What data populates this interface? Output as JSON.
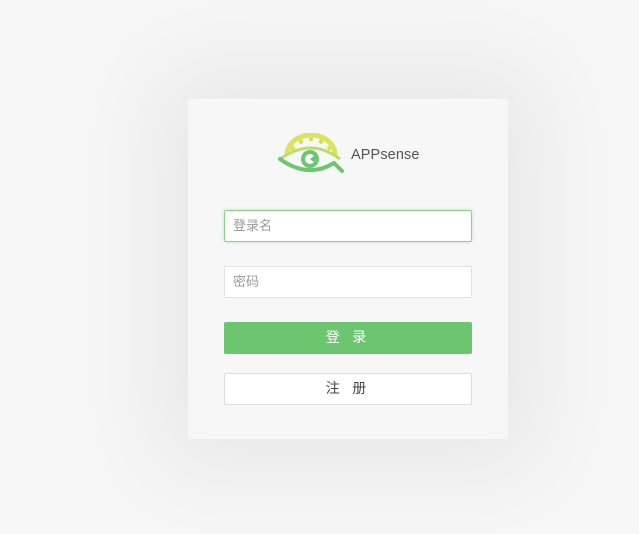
{
  "brand": {
    "name": "APPsense",
    "logo_icon": "eye-gear-logo-icon",
    "colors": {
      "gear": "#d8df4f",
      "eye": "#6cc66f",
      "eye_light": "#a9dc73"
    }
  },
  "login_form": {
    "username_placeholder": "登录名",
    "password_placeholder": "密码",
    "login_label": "登 录",
    "register_label": "注 册"
  },
  "colors": {
    "accent": "#6cc66f",
    "background": "#f6f6f6",
    "card": "#f7f7f7"
  }
}
